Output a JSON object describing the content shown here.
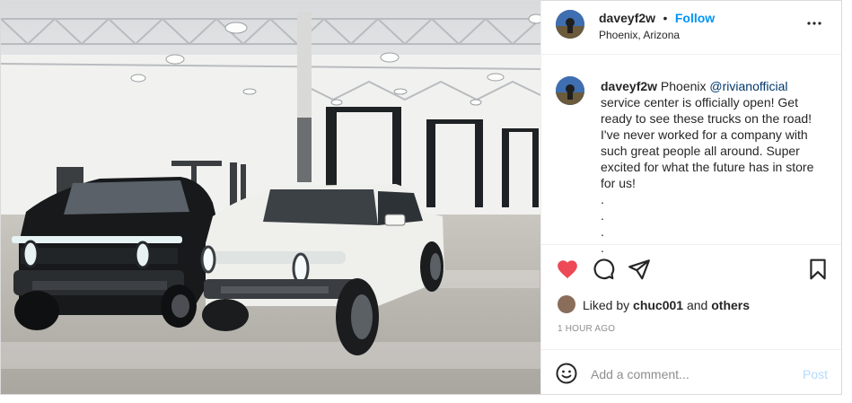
{
  "post": {
    "username": "daveyf2w",
    "separator": "•",
    "follow_label": "Follow",
    "location": "Phoenix, Arizona",
    "photo_alt": "Two Rivian trucks in a service center",
    "caption": {
      "username": "daveyf2w",
      "text_before": " Phoenix ",
      "mention": "@rivianofficial",
      "text_after": " service center is officially open! Get ready to see these trucks on the road! I've never worked for a company with such great people all around. Super excited for what the future has in store for us!",
      "dots": [
        ".",
        ".",
        ".",
        "."
      ]
    },
    "likes": {
      "prefix": "Liked by ",
      "user": "chuc001",
      "middle": " and ",
      "others": "others"
    },
    "timestamp": "1 HOUR AGO",
    "comment": {
      "placeholder": "Add a comment...",
      "post_label": "Post"
    }
  },
  "icons": {
    "more": "more-options-icon",
    "like": "heart-icon",
    "comment": "comment-icon",
    "share": "share-icon",
    "save": "bookmark-icon",
    "emoji": "emoji-icon"
  },
  "colors": {
    "heart": "#ed4956",
    "link": "#0095f6",
    "post_disabled": "#b3dbff"
  }
}
